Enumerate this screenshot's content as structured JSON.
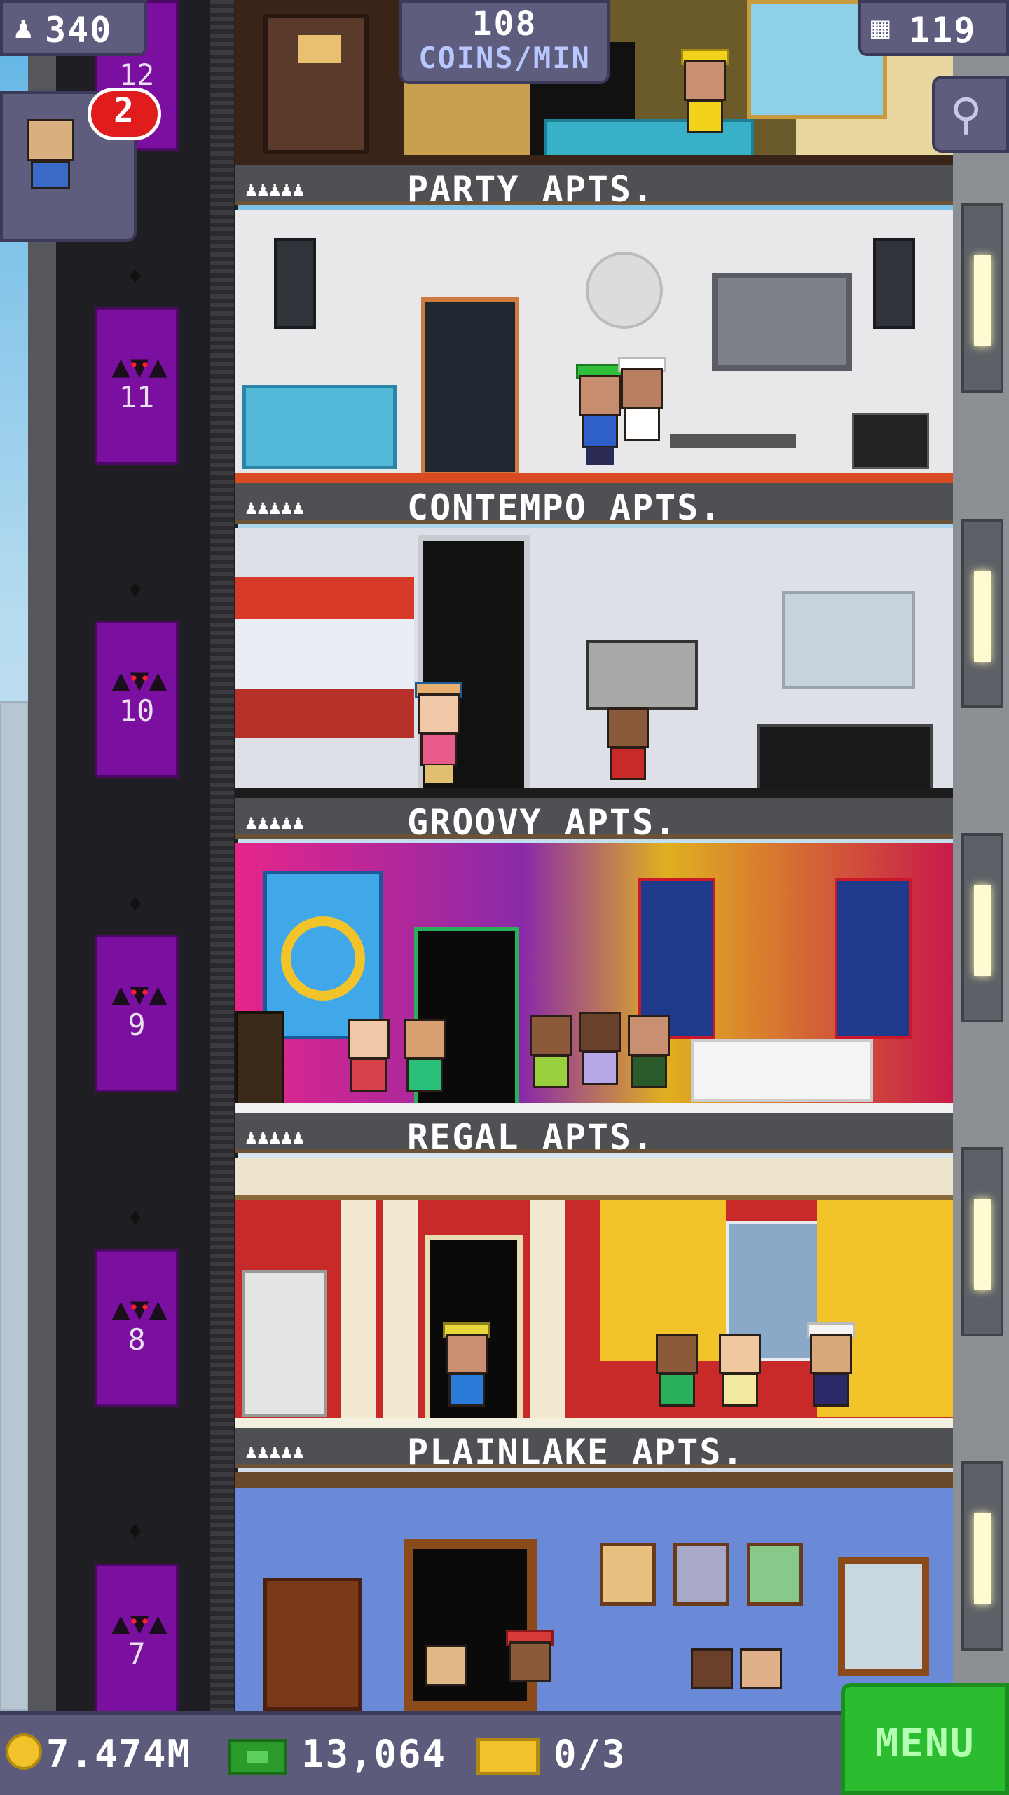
{
  "hud": {
    "population": "340",
    "coins_per_min_value": "108",
    "coins_per_min_label": "COINS/MIN",
    "floor_count": "119",
    "notification_badge": "2",
    "top_floor_number_partial": "12"
  },
  "floors": [
    {
      "name": "PARTY APTS.",
      "number": "11",
      "residents_icons": "♟♟♟♟♟"
    },
    {
      "name": "CONTEMPO APTS.",
      "number": "10",
      "residents_icons": "♟♟♟♟♟"
    },
    {
      "name": "GROOVY APTS.",
      "number": "9",
      "residents_icons": "♟♟♟♟♟"
    },
    {
      "name": "REGAL APTS.",
      "number": "8",
      "residents_icons": "♟♟♟♟♟"
    },
    {
      "name": "PLAINLAKE APTS.",
      "number": "7",
      "residents_icons": "♟♟♟♟♟"
    }
  ],
  "bottom_bar": {
    "coins": "7.474M",
    "bux": "13,064",
    "tickets": "0/3",
    "menu_label": "MENU"
  },
  "icons": {
    "population": "person-icon",
    "floors": "building-icon",
    "search": "magnifier-icon",
    "coin": "coin-icon",
    "bux": "cash-icon",
    "ticket": "ticket-icon",
    "bat": "bat-icon"
  },
  "colors": {
    "hud_bg": "#5e5d7e",
    "menu_green": "#2bbd2f",
    "shaft_purple": "#7a0fa0",
    "badge_red": "#e01c1c"
  }
}
